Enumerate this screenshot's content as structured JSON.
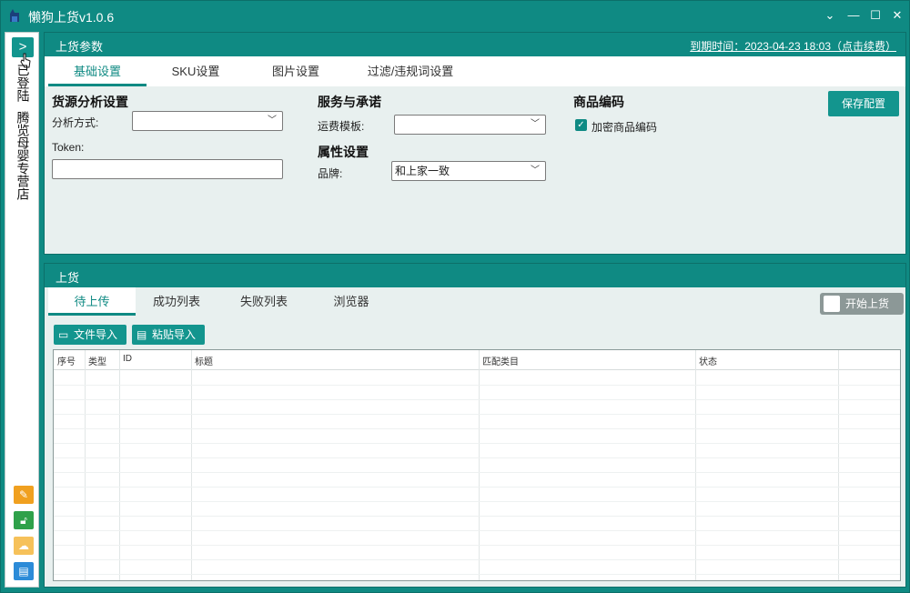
{
  "window": {
    "title": "懒狗上货v1.0.6",
    "controls": {
      "minimize": "⌄",
      "restore": "—",
      "maximize": "☐",
      "close": "✕"
    }
  },
  "sidebar": {
    "expand_label": ">",
    "status_text": "已登陆",
    "shop_name": "腾览母婴专营店",
    "icons": [
      "edit-icon",
      "unlock-icon",
      "cloud-icon",
      "store-icon"
    ],
    "icon_colors": [
      "#f0a020",
      "#2fa14a",
      "#f6c15a",
      "#2c8bd8"
    ]
  },
  "params_panel": {
    "title": "上货参数",
    "expire_text": "到期时间：2023-04-23 18:03（点击续费）",
    "tabs": [
      "基础设置",
      "SKU设置",
      "图片设置",
      "过滤/违规词设置"
    ],
    "active_tab": 0,
    "source_section": {
      "heading": "货源分析设置",
      "method_label": "分析方式:",
      "method_value": "",
      "token_label": "Token:",
      "token_value": ""
    },
    "service_section": {
      "heading": "服务与承诺",
      "freight_label": "运费模板:",
      "freight_value": ""
    },
    "attr_section": {
      "heading": "属性设置",
      "brand_label": "品牌:",
      "brand_value": "和上家一致"
    },
    "code_section": {
      "heading": "商品编码",
      "encrypt_label": "加密商品编码",
      "encrypt_checked": true
    },
    "save_button": "保存配置"
  },
  "upload_panel": {
    "title": "上货",
    "tabs": [
      "待上传",
      "成功列表",
      "失败列表",
      "浏览器"
    ],
    "active_tab": 0,
    "start_toggle_label": "开始上货",
    "file_import": "文件导入",
    "paste_import": "粘贴导入",
    "table": {
      "columns": [
        "序号",
        "类型",
        "ID",
        "标题",
        "匹配类目",
        "状态"
      ],
      "rows": []
    }
  },
  "colors": {
    "accent": "#0f8a83",
    "panel_bg": "#e8f0ef"
  }
}
